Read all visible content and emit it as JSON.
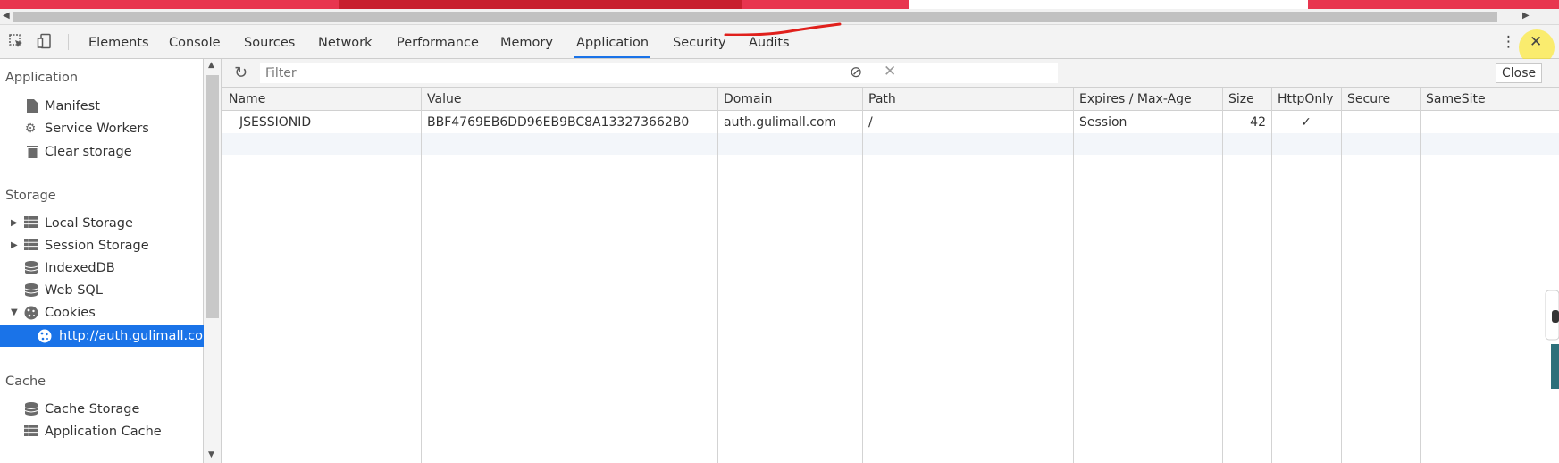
{
  "toolbar": {
    "tabs": [
      {
        "label": "Elements"
      },
      {
        "label": "Console"
      },
      {
        "label": "Sources"
      },
      {
        "label": "Network"
      },
      {
        "label": "Performance"
      },
      {
        "label": "Memory"
      },
      {
        "label": "Application",
        "active": true
      },
      {
        "label": "Security"
      },
      {
        "label": "Audits"
      }
    ],
    "close_tooltip": "Close"
  },
  "sidebar": {
    "application": {
      "title": "Application",
      "items": [
        {
          "label": "Manifest",
          "icon": "document-icon"
        },
        {
          "label": "Service Workers",
          "icon": "gear-icon"
        },
        {
          "label": "Clear storage",
          "icon": "trash-icon"
        }
      ]
    },
    "storage": {
      "title": "Storage",
      "items": [
        {
          "label": "Local Storage",
          "icon": "grid-icon"
        },
        {
          "label": "Session Storage",
          "icon": "grid-icon"
        },
        {
          "label": "IndexedDB",
          "icon": "database-icon"
        },
        {
          "label": "Web SQL",
          "icon": "database-icon"
        },
        {
          "label": "Cookies",
          "icon": "cookie-icon"
        },
        {
          "label": "http://auth.gulimall.com",
          "icon": "cookie-icon",
          "selected": true
        }
      ]
    },
    "cache": {
      "title": "Cache",
      "items": [
        {
          "label": "Cache Storage",
          "icon": "database-icon"
        },
        {
          "label": "Application Cache",
          "icon": "grid-icon"
        }
      ]
    }
  },
  "filter": {
    "placeholder": "Filter"
  },
  "cookies_table": {
    "columns": [
      "Name",
      "Value",
      "Domain",
      "Path",
      "Expires / Max-Age",
      "Size",
      "HttpOnly",
      "Secure",
      "SameSite"
    ],
    "rows": [
      {
        "name": "JSESSIONID",
        "value": "BBF4769EB6DD96EB9BC8A133273662B0",
        "domain": "auth.gulimall.com",
        "path": "/",
        "expires": "Session",
        "size": "42",
        "httponly": "✓",
        "secure": "",
        "samesite": ""
      }
    ]
  },
  "colors": {
    "accent": "#1a73e8",
    "annotation": "#e0201c"
  }
}
